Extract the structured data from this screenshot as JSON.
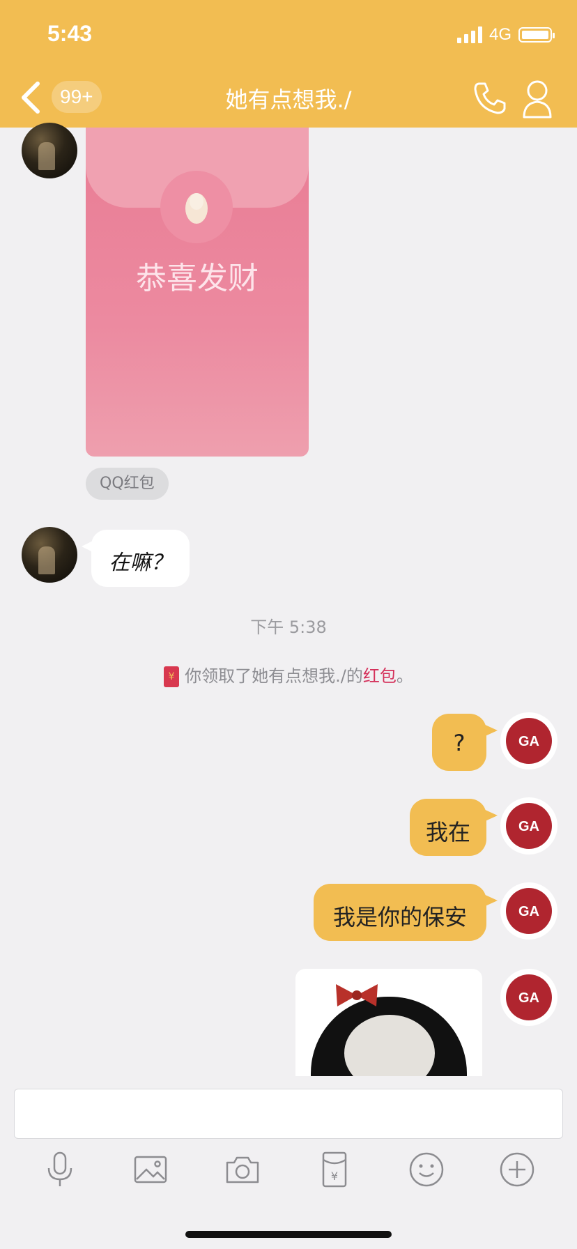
{
  "status_bar": {
    "time": "5:43",
    "network": "4G"
  },
  "header": {
    "unread_count": "99+",
    "title": "她有点想我./"
  },
  "messages": {
    "red_packet_text": "恭喜发财",
    "red_packet_label": "QQ红包",
    "incoming_text": "在嘛？",
    "timestamp": "下午 5:38",
    "system_prefix": "你领取了她有点想我./的",
    "system_link": "红包",
    "system_suffix": "。",
    "out_1": "?",
    "out_2": "我在",
    "out_3": "我是你的保安",
    "avatar_logo_text": "GA"
  },
  "toolbar": {
    "icons": [
      "microphone-icon",
      "image-icon",
      "camera-icon",
      "red-packet-icon",
      "emoji-icon",
      "plus-icon"
    ]
  },
  "colors": {
    "accent": "#f2bd52",
    "red_packet": "#e97c94",
    "link": "#d4305a"
  }
}
